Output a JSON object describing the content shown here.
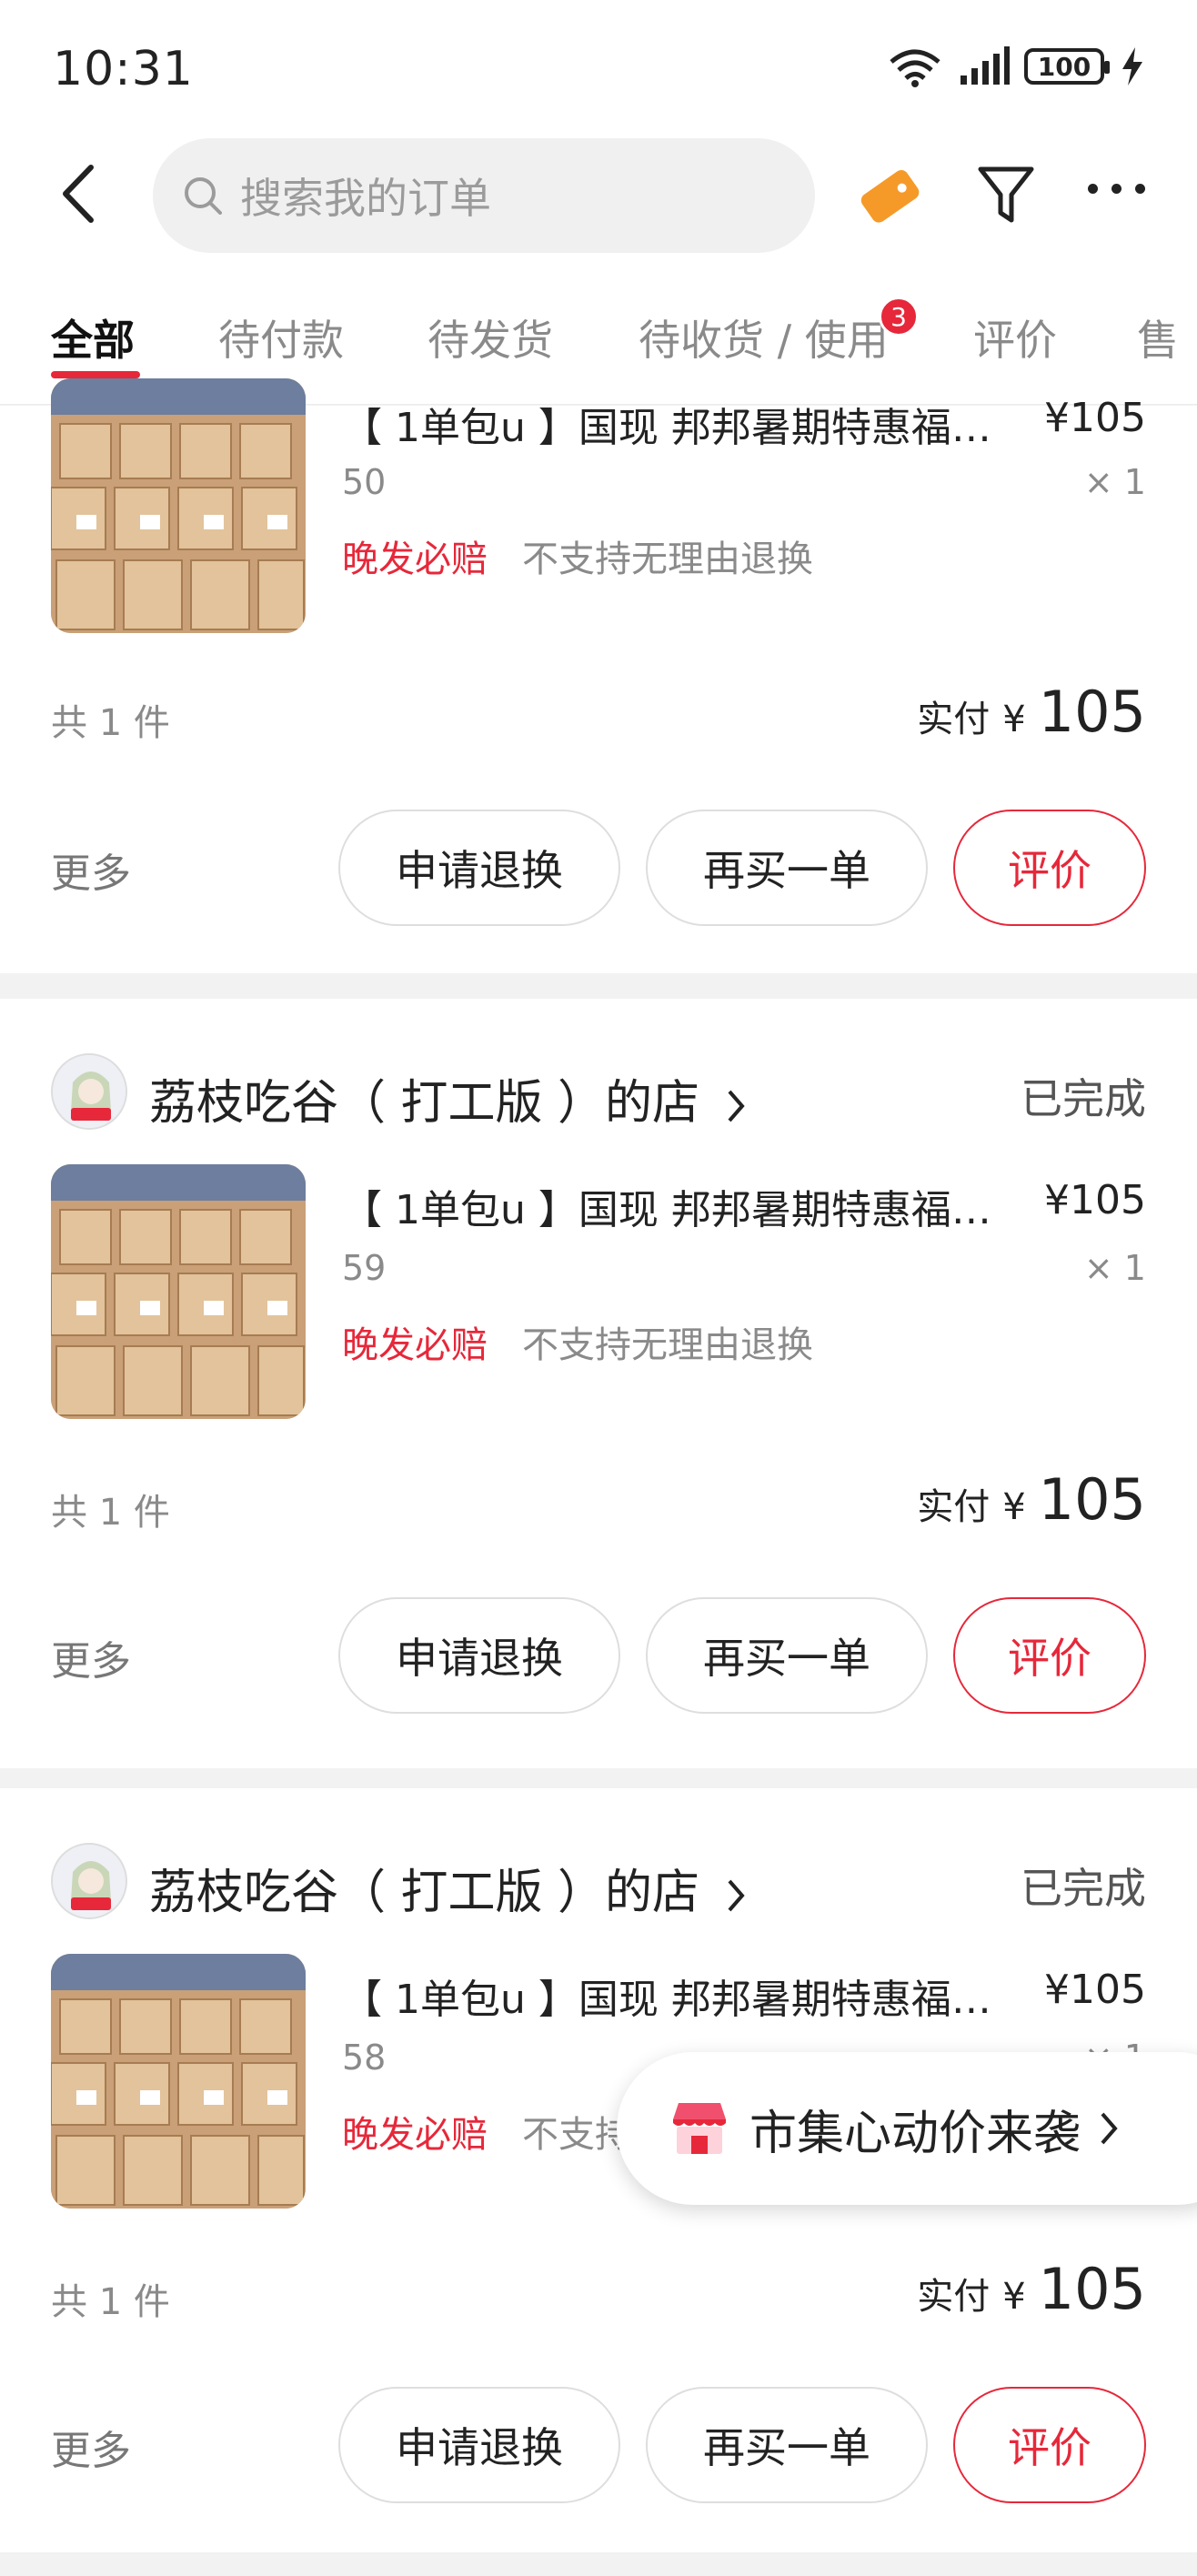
{
  "status_bar": {
    "time": "10:31",
    "battery": "100"
  },
  "header": {
    "search_placeholder": "搜索我的订单"
  },
  "tabs": [
    {
      "label": "全部"
    },
    {
      "label": "待付款"
    },
    {
      "label": "待发货"
    },
    {
      "label": "待收货 / 使用",
      "badge": "3"
    },
    {
      "label": "评价"
    },
    {
      "label": "售"
    }
  ],
  "orders": [
    {
      "shop_name": "",
      "status": "",
      "item_title": "【 1单包u 】国现 邦邦暑期特惠福…",
      "price": "¥105",
      "spec": "50",
      "qty": "× 1",
      "tag_red": "晚发必赔",
      "tag_grey": "不支持无理由退换",
      "count": "共 1 件",
      "paid_label": "实付",
      "currency": "¥",
      "paid_amount": "105",
      "more": "更多",
      "btn_refund": "申请退换",
      "btn_rebuy": "再买一单",
      "btn_review": "评价"
    },
    {
      "shop_name": "荔枝吃谷（ 打工版 ）的店",
      "status": "已完成",
      "item_title": "【 1单包u 】国现 邦邦暑期特惠福…",
      "price": "¥105",
      "spec": "59",
      "qty": "× 1",
      "tag_red": "晚发必赔",
      "tag_grey": "不支持无理由退换",
      "count": "共 1 件",
      "paid_label": "实付",
      "currency": "¥",
      "paid_amount": "105",
      "more": "更多",
      "btn_refund": "申请退换",
      "btn_rebuy": "再买一单",
      "btn_review": "评价"
    },
    {
      "shop_name": "荔枝吃谷（ 打工版 ）的店",
      "status": "已完成",
      "item_title": "【 1单包u 】国现 邦邦暑期特惠福…",
      "price": "¥105",
      "spec": "58",
      "qty": "× 1",
      "tag_red": "晚发必赔",
      "tag_grey": "不支持无理由退换",
      "count": "共 1 件",
      "paid_label": "实付",
      "currency": "¥",
      "paid_amount": "105",
      "more": "更多",
      "btn_refund": "申请退换",
      "btn_rebuy": "再买一单",
      "btn_review": "评价"
    }
  ],
  "floating_banner": {
    "text": "市集心动价来袭"
  },
  "colors": {
    "accent": "#e6283a",
    "background": "#f2f2f2",
    "card": "#ffffff"
  },
  "icons": [
    "back-arrow-icon",
    "search-icon",
    "coupon-icon",
    "filter-icon",
    "more-icon",
    "wifi-icon",
    "signal-icon",
    "battery-icon",
    "chevron-right-icon",
    "market-store-icon"
  ]
}
